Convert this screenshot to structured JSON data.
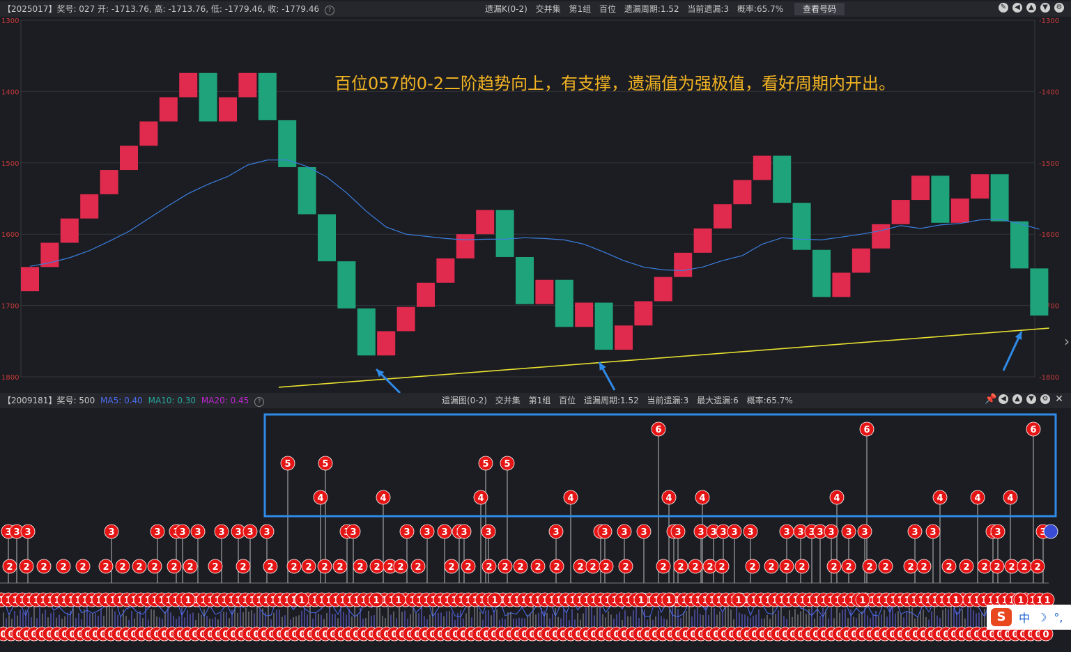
{
  "top_bar": {
    "info_prefix": "【2025017】奖号: 027  开: -1713.76, 高: -1713.76, 低: -1779.46, 收: -1779.46",
    "title": "遗漏K(0-2)",
    "items": [
      "交并集",
      "第1组",
      "百位",
      "遗漏周期:1.52",
      "当前遗漏:3",
      "概率:65.7%"
    ],
    "button": "查看号码"
  },
  "annotation": "百位057的0-2二阶趋势向上，有支撑，遗漏值为强极值，看好周期内开出。",
  "bottom_bar": {
    "info_prefix": "【2009181】奖号: 500",
    "ma5": "MA5: 0.40",
    "ma10": "MA10: 0.30",
    "ma20": "MA20: 0.45",
    "title": "遗漏图(0-2)",
    "items": [
      "交并集",
      "第1组",
      "百位",
      "遗漏周期:1.52",
      "当前遗漏:3",
      "最大遗漏:6",
      "概率:65.7%"
    ]
  },
  "ime": {
    "mode": "中"
  },
  "colors": {
    "up": "#e02b4f",
    "down": "#1fa37b",
    "ma": "#3a7fe0",
    "support": "#e8e030",
    "arrow": "#2f8be8",
    "bubble": "#e51515",
    "highlight_box": "#2f8be8",
    "ma5": "#4a6cf0",
    "ma10": "#26a69a",
    "ma20": "#c026d3"
  },
  "chart_data": {
    "type": "candlestick",
    "ylim": [
      -1800,
      -1300
    ],
    "yticks": [
      -1300,
      -1400,
      -1500,
      -1600,
      -1700,
      -1800
    ],
    "ytick_labels": [
      "1300",
      "1400",
      "1500",
      "1600",
      "1700",
      "1800"
    ],
    "ytick_labels_right": [
      "-1300",
      "-1400",
      "-1500",
      "-1600",
      "-1700",
      "-1800"
    ],
    "candles": [
      {
        "open": -1680,
        "close": -1646
      },
      {
        "open": -1646,
        "close": -1612
      },
      {
        "open": -1612,
        "close": -1578
      },
      {
        "open": -1578,
        "close": -1544
      },
      {
        "open": -1544,
        "close": -1510
      },
      {
        "open": -1510,
        "close": -1476
      },
      {
        "open": -1476,
        "close": -1442
      },
      {
        "open": -1442,
        "close": -1408
      },
      {
        "open": -1408,
        "close": -1374
      },
      {
        "open": -1374,
        "close": -1442
      },
      {
        "open": -1442,
        "close": -1408
      },
      {
        "open": -1408,
        "close": -1374
      },
      {
        "open": -1374,
        "close": -1440
      },
      {
        "open": -1440,
        "close": -1506
      },
      {
        "open": -1506,
        "close": -1572
      },
      {
        "open": -1572,
        "close": -1638
      },
      {
        "open": -1638,
        "close": -1704
      },
      {
        "open": -1704,
        "close": -1770
      },
      {
        "open": -1770,
        "close": -1736
      },
      {
        "open": -1736,
        "close": -1702
      },
      {
        "open": -1702,
        "close": -1668
      },
      {
        "open": -1668,
        "close": -1634
      },
      {
        "open": -1634,
        "close": -1600
      },
      {
        "open": -1600,
        "close": -1566
      },
      {
        "open": -1566,
        "close": -1632
      },
      {
        "open": -1632,
        "close": -1698
      },
      {
        "open": -1698,
        "close": -1664
      },
      {
        "open": -1664,
        "close": -1730
      },
      {
        "open": -1730,
        "close": -1696
      },
      {
        "open": -1696,
        "close": -1762
      },
      {
        "open": -1762,
        "close": -1728
      },
      {
        "open": -1728,
        "close": -1694
      },
      {
        "open": -1694,
        "close": -1660
      },
      {
        "open": -1660,
        "close": -1626
      },
      {
        "open": -1626,
        "close": -1592
      },
      {
        "open": -1592,
        "close": -1558
      },
      {
        "open": -1558,
        "close": -1524
      },
      {
        "open": -1524,
        "close": -1490
      },
      {
        "open": -1490,
        "close": -1556
      },
      {
        "open": -1556,
        "close": -1622
      },
      {
        "open": -1622,
        "close": -1688
      },
      {
        "open": -1688,
        "close": -1654
      },
      {
        "open": -1654,
        "close": -1620
      },
      {
        "open": -1620,
        "close": -1586
      },
      {
        "open": -1586,
        "close": -1552
      },
      {
        "open": -1552,
        "close": -1518
      },
      {
        "open": -1518,
        "close": -1584
      },
      {
        "open": -1584,
        "close": -1550
      },
      {
        "open": -1550,
        "close": -1516
      },
      {
        "open": -1516,
        "close": -1582
      },
      {
        "open": -1582,
        "close": -1648
      },
      {
        "open": -1648,
        "close": -1714
      }
    ],
    "ma": [
      -1645,
      -1640,
      -1633,
      -1623,
      -1610,
      -1596,
      -1578,
      -1560,
      -1543,
      -1530,
      -1519,
      -1503,
      -1496,
      -1496,
      -1505,
      -1520,
      -1542,
      -1568,
      -1590,
      -1600,
      -1603,
      -1606,
      -1608,
      -1607,
      -1607,
      -1605,
      -1606,
      -1608,
      -1614,
      -1625,
      -1637,
      -1646,
      -1650,
      -1651,
      -1646,
      -1637,
      -1630,
      -1614,
      -1605,
      -1607,
      -1608,
      -1604,
      -1600,
      -1595,
      -1588,
      -1592,
      -1587,
      -1585,
      -1580,
      -1579,
      -1585,
      -1593
    ],
    "support_line": {
      "from": [
        0,
        -1798
      ],
      "to": [
        51.5,
        -1720
      ]
    }
  },
  "omission_chart": {
    "type": "scatter",
    "ylim": [
      0,
      6
    ],
    "peaks": [
      {
        "x": 413,
        "v": 5
      },
      {
        "x": 467,
        "v": 5
      },
      {
        "x": 460,
        "v": 4
      },
      {
        "x": 550,
        "v": 4
      },
      {
        "x": 690,
        "v": 4
      },
      {
        "x": 697,
        "v": 5
      },
      {
        "x": 728,
        "v": 5
      },
      {
        "x": 819,
        "v": 4
      },
      {
        "x": 945,
        "v": 6
      },
      {
        "x": 960,
        "v": 4
      },
      {
        "x": 1008,
        "v": 4
      },
      {
        "x": 1201,
        "v": 4
      },
      {
        "x": 1244,
        "v": 6
      },
      {
        "x": 1349,
        "v": 4
      },
      {
        "x": 1403,
        "v": 4
      },
      {
        "x": 1450,
        "v": 4
      },
      {
        "x": 1483,
        "v": 6
      }
    ],
    "threes": [
      12,
      24,
      40,
      160,
      226,
      253,
      262,
      284,
      318,
      342,
      359,
      383,
      498,
      507,
      584,
      613,
      638,
      659,
      666,
      701,
      798,
      862,
      868,
      896,
      924,
      967,
      973,
      1006,
      1024,
      1038,
      1054,
      1077,
      1129,
      1149,
      1165,
      1177,
      1193,
      1218,
      1241,
      1313,
      1339,
      1425,
      1432,
      1497
    ],
    "twos": [
      14,
      38,
      63,
      91,
      119,
      152,
      176,
      200,
      222,
      250,
      273,
      309,
      349,
      388,
      422,
      443,
      466,
      488,
      517,
      541,
      560,
      575,
      600,
      648,
      672,
      702,
      725,
      747,
      772,
      799,
      833,
      851,
      870,
      898,
      952,
      977,
      998,
      1019,
      1036,
      1080,
      1107,
      1129,
      1151,
      1197,
      1218,
      1248,
      1271,
      1307,
      1326,
      1362,
      1387,
      1413,
      1431,
      1452,
      1470,
      1489
    ],
    "ones": [
      270,
      433,
      540,
      572,
      710,
      920,
      960,
      1060,
      1238,
      1372,
      1465,
      1503
    ],
    "last_zero": 1503
  }
}
